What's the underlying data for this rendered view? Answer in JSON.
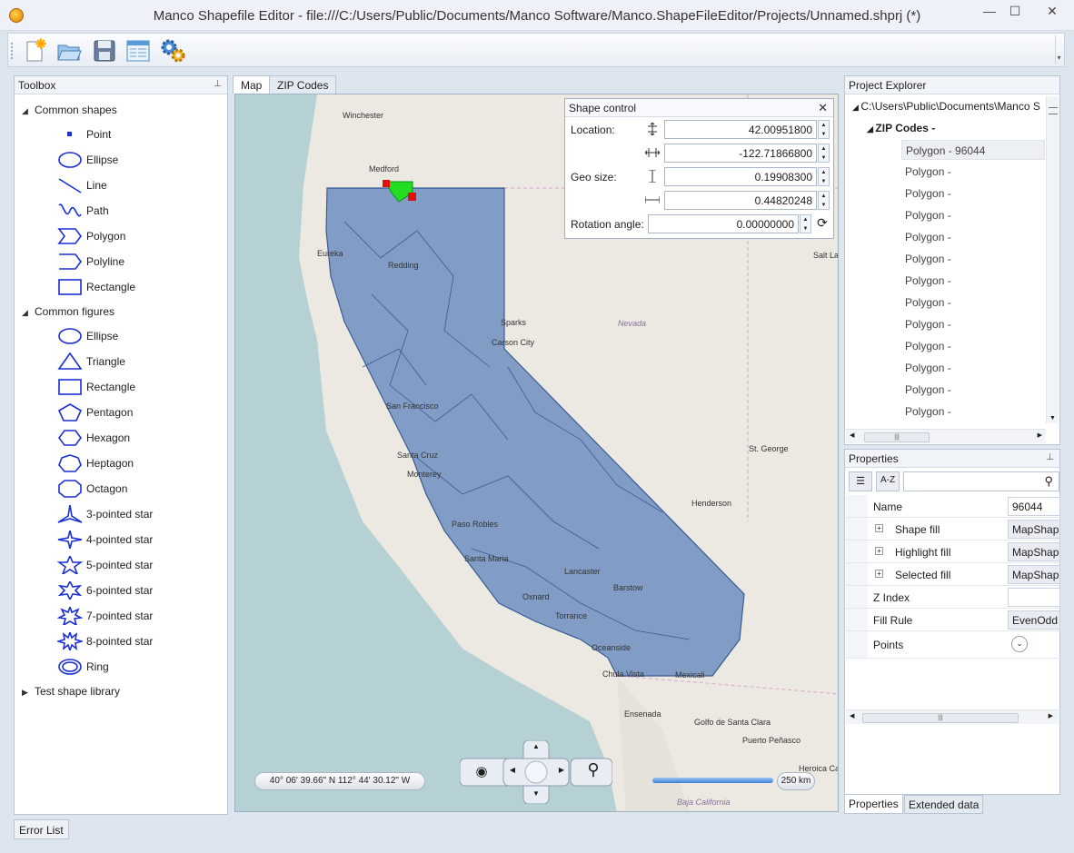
{
  "window": {
    "title": "Manco Shapefile Editor - file:///C:/Users/Public/Documents/Manco Software/Manco.ShapeFileEditor/Projects/Unnamed.shprj (*)",
    "minimize": "—",
    "maximize": "☐",
    "close": "✕"
  },
  "toolbar": {
    "buttons": [
      "new-icon",
      "open-folder-icon",
      "save-icon",
      "properties-window-icon",
      "settings-gears-icon"
    ]
  },
  "toolbox": {
    "title": "Toolbox",
    "groups": [
      {
        "label": "Common shapes",
        "items": [
          "Point",
          "Ellipse",
          "Line",
          "Path",
          "Polygon",
          "Polyline",
          "Rectangle"
        ]
      },
      {
        "label": "Common figures",
        "items": [
          "Ellipse",
          "Triangle",
          "Rectangle",
          "Pentagon",
          "Hexagon",
          "Heptagon",
          "Octagon",
          "3-pointed star",
          "4-pointed star",
          "5-pointed star",
          "6-pointed star",
          "7-pointed star",
          "8-pointed star",
          "Ring"
        ]
      },
      {
        "label": "Test shape library",
        "items": []
      }
    ]
  },
  "map": {
    "tabs": [
      "Map",
      "ZIP Codes"
    ],
    "active_tab": "Map",
    "coordinates": "40° 06' 39.66\" N 112° 44' 30.12\" W",
    "scale": "250 km",
    "places": [
      "Winchester",
      "Medford",
      "Eureka",
      "Redding",
      "Salt La",
      "Sparks",
      "Carson City",
      "Nevada",
      "San Francisco",
      "Santa Cruz",
      "Monterey",
      "St. George",
      "Henderson",
      "Paso Robles",
      "Santa Maria",
      "Lancaster",
      "Barstow",
      "Oxnard",
      "Torrance",
      "Oceanside",
      "Chula Vista",
      "Mexicali",
      "Ensenada",
      "Golfo de Santa Clara",
      "Puerto Peñasco",
      "Heroica Ca",
      "Baja California"
    ]
  },
  "shape_control": {
    "title": "Shape control",
    "location_label": "Location:",
    "geo_size_label": "Geo size:",
    "rotation_label": "Rotation angle:",
    "latitude": "42.00951800",
    "longitude": "-122.71866800",
    "height": "0.19908300",
    "width": "0.44820248",
    "rotation": "0.00000000"
  },
  "project_explorer": {
    "title": "Project Explorer",
    "path": "C:\\Users\\Public\\Documents\\Manco S",
    "root": "ZIP Codes -",
    "items": [
      "Polygon - 96044",
      "Polygon -",
      "Polygon -",
      "Polygon -",
      "Polygon -",
      "Polygon -",
      "Polygon -",
      "Polygon -",
      "Polygon -",
      "Polygon -",
      "Polygon -",
      "Polygon -",
      "Polygon -",
      "Polygon -"
    ]
  },
  "properties": {
    "title": "Properties",
    "sort_label": "A-Z",
    "rows": [
      {
        "name": "Name",
        "value": "96044",
        "kind": "plain"
      },
      {
        "name": "Shape fill",
        "value": "MapShap",
        "kind": "expand"
      },
      {
        "name": "Highlight fill",
        "value": "MapShap",
        "kind": "expand"
      },
      {
        "name": "Selected fill",
        "value": "MapShap",
        "kind": "expand"
      },
      {
        "name": "Z Index",
        "value": "",
        "kind": "plain"
      },
      {
        "name": "Fill Rule",
        "value": "EvenOdd",
        "kind": "plain"
      },
      {
        "name": "Points",
        "value": "",
        "kind": "dropdown"
      }
    ]
  },
  "bottom_tabs": [
    "Properties",
    "Extended data"
  ],
  "error_list": "Error List",
  "colors": {
    "accent": "#2b57c9",
    "state_fill": "#6e8fbf",
    "state_stroke": "#3a5a95",
    "selected_shape": "#22dd22",
    "selection_handle": "#e01010"
  }
}
